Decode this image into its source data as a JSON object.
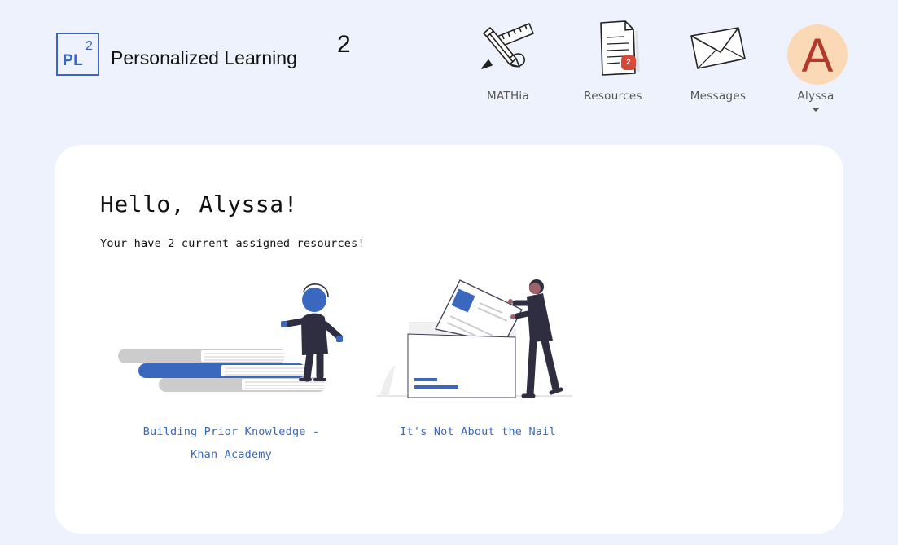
{
  "header": {
    "logo": {
      "text": "PL",
      "superscript": "2"
    },
    "title": "Personalized Learning",
    "title_superscript": "2"
  },
  "nav": {
    "mathia": {
      "label": "MATHia",
      "icon": "pencil-ruler-icon"
    },
    "resources": {
      "label": "Resources",
      "icon": "document-icon",
      "badge": "2"
    },
    "messages": {
      "label": "Messages",
      "icon": "envelope-icon"
    },
    "user": {
      "label": "Alyssa",
      "avatar_letter": "A",
      "icon": "chevron-down-icon"
    }
  },
  "main": {
    "greeting": "Hello, Alyssa!",
    "subtext": "Your have 2 current assigned resources!",
    "resources": [
      {
        "line1": "Building Prior Knowledge -",
        "line2": "Khan Academy",
        "illustration": "books-stairs-illustration"
      },
      {
        "line1": "It's Not About the Nail",
        "line2": "",
        "illustration": "file-folder-illustration"
      }
    ]
  },
  "colors": {
    "background": "#eef2fc",
    "accent": "#3a68bf",
    "badge": "#d84a37",
    "avatar_bg": "#fcd9b6",
    "avatar_text": "#b2392b"
  }
}
